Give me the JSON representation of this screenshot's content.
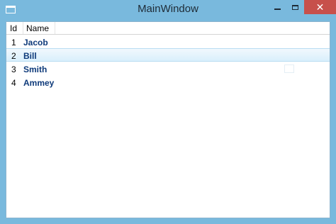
{
  "window": {
    "title": "MainWindow",
    "controls": {
      "close_glyph": "✕"
    }
  },
  "list": {
    "columns": [
      "Id",
      "Name"
    ],
    "rows": [
      {
        "id": "1",
        "name": "Jacob"
      },
      {
        "id": "2",
        "name": "Bill",
        "selected": true
      },
      {
        "id": "3",
        "name": "Smith"
      },
      {
        "id": "4",
        "name": "Ammey"
      }
    ]
  },
  "colors": {
    "frame": "#79b9dd",
    "close_button": "#c7504b",
    "name_text": "#0e3a7a",
    "selection": "#d9effc"
  }
}
